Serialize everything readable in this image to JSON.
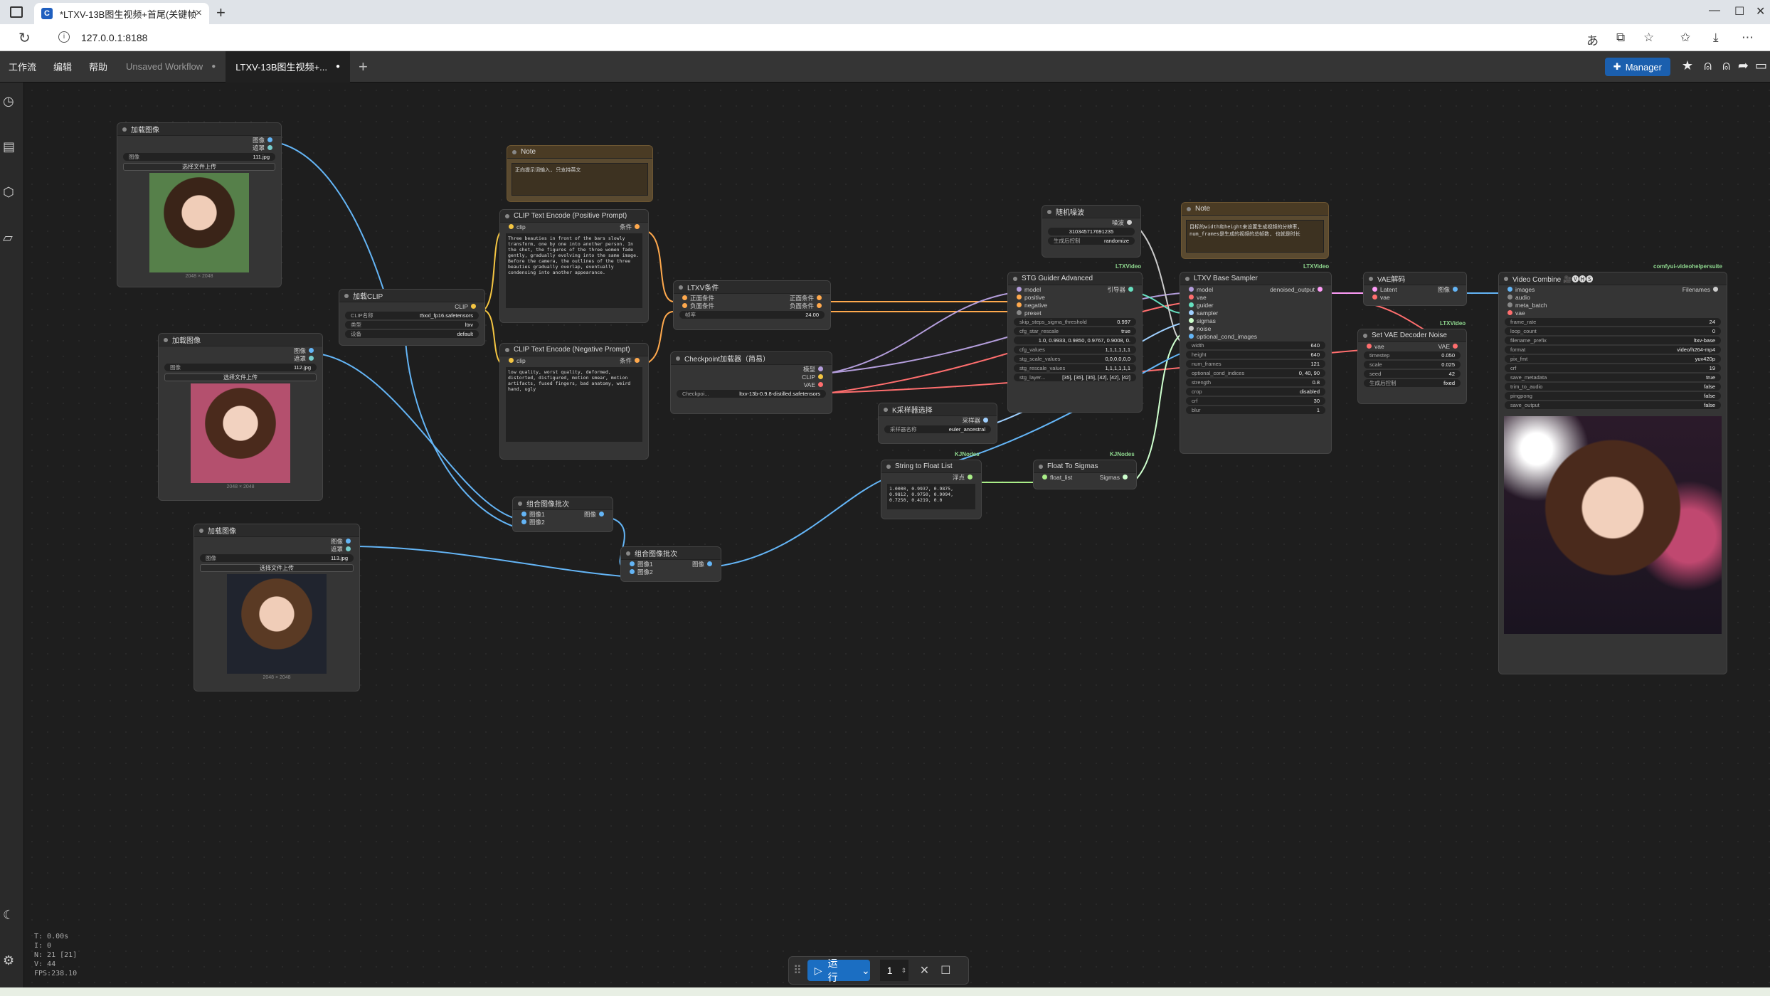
{
  "browser": {
    "tab_title": "*LTXV-13B图生视频+首尾(关键帧",
    "url": "127.0.0.1:8188"
  },
  "menubar": {
    "menus": [
      "工作流",
      "编辑",
      "帮助"
    ],
    "tabs": [
      {
        "label": "Unsaved Workflow",
        "mark": "●"
      },
      {
        "label": "LTXV-13B图生视频+...",
        "mark": "●"
      }
    ],
    "manager_label": "Manager"
  },
  "nodes": {
    "load1": {
      "title": "加载图像",
      "out1": "图像",
      "out2": "遮罩",
      "image_label": "图像",
      "image_value": "111.jpg",
      "upload": "选择文件上传",
      "size": "2048 × 2048"
    },
    "load2": {
      "title": "加载图像",
      "out1": "图像",
      "out2": "遮罩",
      "image_label": "图像",
      "image_value": "112.jpg",
      "upload": "选择文件上传",
      "size": "2048 × 2048"
    },
    "load3": {
      "title": "加载图像",
      "out1": "图像",
      "out2": "遮罩",
      "image_label": "图像",
      "image_value": "113.jpg",
      "upload": "选择文件上传",
      "size": "2048 × 2048"
    },
    "note1": {
      "title": "Note",
      "text": "正向提示词输入, 只支持英文"
    },
    "note2": {
      "title": "Note",
      "text": "目标的width和height来设置生成视频的分辨率, num_frames是生成的视频的总帧数, 也就是时长"
    },
    "clip_pos": {
      "title": "CLIP Text Encode (Positive Prompt)",
      "in": "clip",
      "out": "条件",
      "text": "Three beauties in front of the bars slowly transform, one by one into another person. In the shot, the figures of the three women fade gently, gradually evolving into the same image. Before the camera, the outlines of the three beauties gradually overlap, eventually condensing into another appearance."
    },
    "clip_neg": {
      "title": "CLIP Text Encode (Negative Prompt)",
      "in": "clip",
      "out": "条件",
      "text": "low quality, worst quality, deformed, distorted, disfigured, motion smear, motion artifacts, fused fingers, bad anatomy, weird hand, ugly"
    },
    "load_clip": {
      "title": "加载CLIP",
      "out": "CLIP",
      "w1_label": "CLIP名称",
      "w1_value": "t5xxl_fp16.safetensors",
      "w2_label": "类型",
      "w2_value": "ltxv",
      "w3_label": "设备",
      "w3_value": "default"
    },
    "ltxv_cond": {
      "title": "LTXV条件",
      "in1": "正面条件",
      "in2": "负面条件",
      "out1": "正面条件",
      "out2": "负面条件",
      "w_label": "帧率",
      "w_value": "24.00"
    },
    "ckpt": {
      "title": "Checkpoint加载器（简易）",
      "out1": "模型",
      "out2": "CLIP",
      "out3": "VAE",
      "w_label": "Checkpoi...",
      "w_value": "ltxv-13b-0.9.8-distilled.safetensors"
    },
    "noise": {
      "title": "随机噪波",
      "out": "噪波",
      "w1_value": "310345717691235",
      "w2_label": "生成后控制",
      "w2_value": "randomize"
    },
    "stg": {
      "title": "STG Guider Advanced",
      "badge": "LTXVideo",
      "inputs": [
        "model",
        "positive",
        "negative",
        "preset"
      ],
      "out": "引导器",
      "widgets": [
        {
          "k": "skip_steps_sigma_threshold",
          "v": "0.997"
        },
        {
          "k": "cfg_star_rescale",
          "v": "true"
        },
        {
          "k": "",
          "v": "1.0, 0.9933, 0.9850, 0.9767, 0.9008, 0."
        },
        {
          "k": "cfg_values",
          "v": "1,1,1,1,1,1"
        },
        {
          "k": "stg_scale_values",
          "v": "0,0,0,0,0,0"
        },
        {
          "k": "stg_rescale_values",
          "v": "1,1,1,1,1,1"
        },
        {
          "k": "stg_layer...",
          "v": "[35], [35], [35], [42], [42], [42]"
        }
      ]
    },
    "sampler": {
      "title": "LTXV Base Sampler",
      "badge": "LTXVideo",
      "inputs": [
        "model",
        "vae",
        "guider",
        "sampler",
        "sigmas",
        "noise",
        "optional_cond_images"
      ],
      "out": "denoised_output",
      "widgets": [
        {
          "k": "width",
          "v": "640"
        },
        {
          "k": "height",
          "v": "640"
        },
        {
          "k": "num_frames",
          "v": "121"
        },
        {
          "k": "optional_cond_indices",
          "v": "0, 40, 90"
        },
        {
          "k": "strength",
          "v": "0.8"
        },
        {
          "k": "crop",
          "v": "disabled"
        },
        {
          "k": "crf",
          "v": "30"
        },
        {
          "k": "blur",
          "v": "1"
        }
      ]
    },
    "vae_decode": {
      "title": "VAE解码",
      "in1": "Latent",
      "in2": "vae",
      "out": "图像"
    },
    "set_vae": {
      "title": "Set VAE Decoder Noise",
      "badge": "LTXVideo",
      "in": "vae",
      "out": "VAE",
      "widgets": [
        {
          "k": "timestep",
          "v": "0.050"
        },
        {
          "k": "scale",
          "v": "0.025"
        },
        {
          "k": "seed",
          "v": "42"
        },
        {
          "k": "生成后控制",
          "v": "fixed"
        }
      ]
    },
    "video_combine": {
      "title": "Video Combine 🎥🅥🅗🅢",
      "badge": "comfyui-videohelpersuite",
      "inputs": [
        "images",
        "audio",
        "meta_batch",
        "vae"
      ],
      "out": "Filenames",
      "widgets": [
        {
          "k": "frame_rate",
          "v": "24"
        },
        {
          "k": "loop_count",
          "v": "0"
        },
        {
          "k": "filename_prefix",
          "v": "ltxv-base"
        },
        {
          "k": "format",
          "v": "video/h264-mp4"
        },
        {
          "k": "pix_fmt",
          "v": "yuv420p"
        },
        {
          "k": "crf",
          "v": "19"
        },
        {
          "k": "save_metadata",
          "v": "true"
        },
        {
          "k": "trim_to_audio",
          "v": "false"
        },
        {
          "k": "pingpong",
          "v": "false"
        },
        {
          "k": "save_output",
          "v": "false"
        }
      ]
    },
    "ksampler_sel": {
      "title": "K采样器选择",
      "out": "采样器",
      "w_label": "采样器名称",
      "w_value": "euler_ancestral",
      "badge": "KJNodes"
    },
    "str2float": {
      "title": "String to Float List",
      "out": "浮点",
      "text": "1.0000, 0.9937, 0.9875, 0.9812, 0.9750, 0.9094, 0.7250, 0.4219, 0.0",
      "badge": "KJNodes"
    },
    "float2sig": {
      "title": "Float To Sigmas",
      "in": "float_list",
      "out": "Sigmas"
    },
    "batch1": {
      "title": "组合图像批次",
      "in1": "图像1",
      "in2": "图像2",
      "out": "图像"
    },
    "batch2": {
      "title": "组合图像批次",
      "in1": "图像1",
      "in2": "图像2",
      "out": "图像"
    }
  },
  "runbar": {
    "run_label": "运行",
    "count": "1"
  },
  "stats": [
    "T: 0.00s",
    "I: 0",
    "N: 21 [21]",
    "V: 44",
    "FPS:238.10"
  ],
  "colors": {
    "clip": "#f4c542",
    "conditioning": "#ffa94d",
    "image": "#64b5f6",
    "model": "#b39ddb",
    "vae": "#ff6e6e",
    "latent": "#ff9cf9",
    "float": "#aaee88",
    "sigmas": "#cdffcd"
  }
}
